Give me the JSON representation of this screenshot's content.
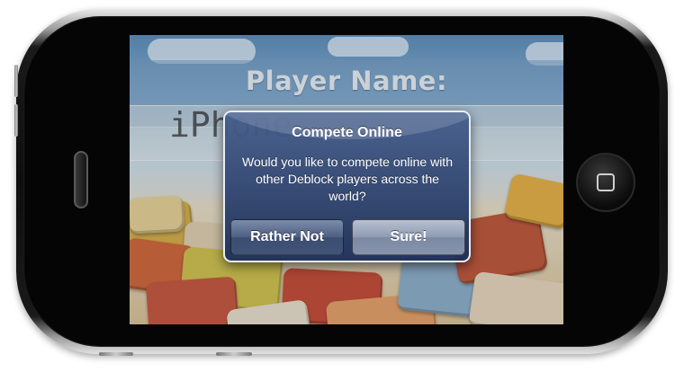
{
  "screen": {
    "header_title": "Player Name:",
    "player_name_value": "iPhone",
    "chevron": "›"
  },
  "alert": {
    "title": "Compete Online",
    "message": "Would you like to compete online with other Deblock players across the world?",
    "cancel_label": "Rather Not",
    "confirm_label": "Sure!"
  },
  "device": {
    "home_button_icon": "rounded-square-icon"
  },
  "colors": {
    "alert_background": "#2c3f6e",
    "alert_border": "#e8eef6",
    "sky": "#8fb7d6"
  }
}
